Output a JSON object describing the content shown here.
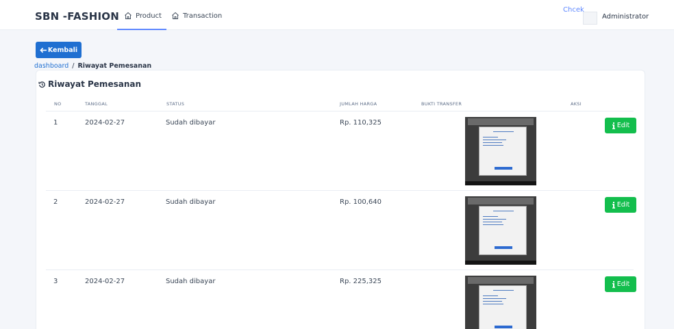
{
  "header": {
    "brand": "SBN -FASHION",
    "tabs": [
      {
        "label": "Product",
        "active": true
      },
      {
        "label": "Transaction",
        "active": false
      }
    ],
    "check_label": "Chcek",
    "user_name": "Administrator"
  },
  "back_button": {
    "label": "Kembali",
    "icon": "arrow-left-icon"
  },
  "breadcrumb": {
    "link": "dashboard",
    "separator": "/",
    "current": "Riwayat Pemesanan"
  },
  "card": {
    "title": "Riwayat Pemesanan",
    "title_icon": "history-icon",
    "columns": [
      "NO",
      "TANGGAL",
      "STATUS",
      "JUMLAH HARGA",
      "BUKTI TRANSFER",
      "AKSI"
    ],
    "rows": [
      {
        "no": "1",
        "date": "2024-02-27",
        "status": "Sudah dibayar",
        "total": "Rp. 110,325",
        "action": "Edit"
      },
      {
        "no": "2",
        "date": "2024-02-27",
        "status": "Sudah dibayar",
        "total": "Rp. 100,640",
        "action": "Edit"
      },
      {
        "no": "3",
        "date": "2024-02-27",
        "status": "Sudah dibayar",
        "total": "Rp. 225,325",
        "action": "Edit"
      }
    ]
  },
  "colors": {
    "primary": "#1f6fd1",
    "accent": "#5d87ff",
    "success": "#13be4d",
    "text": "#2a3547",
    "background": "#f4f6fa"
  }
}
